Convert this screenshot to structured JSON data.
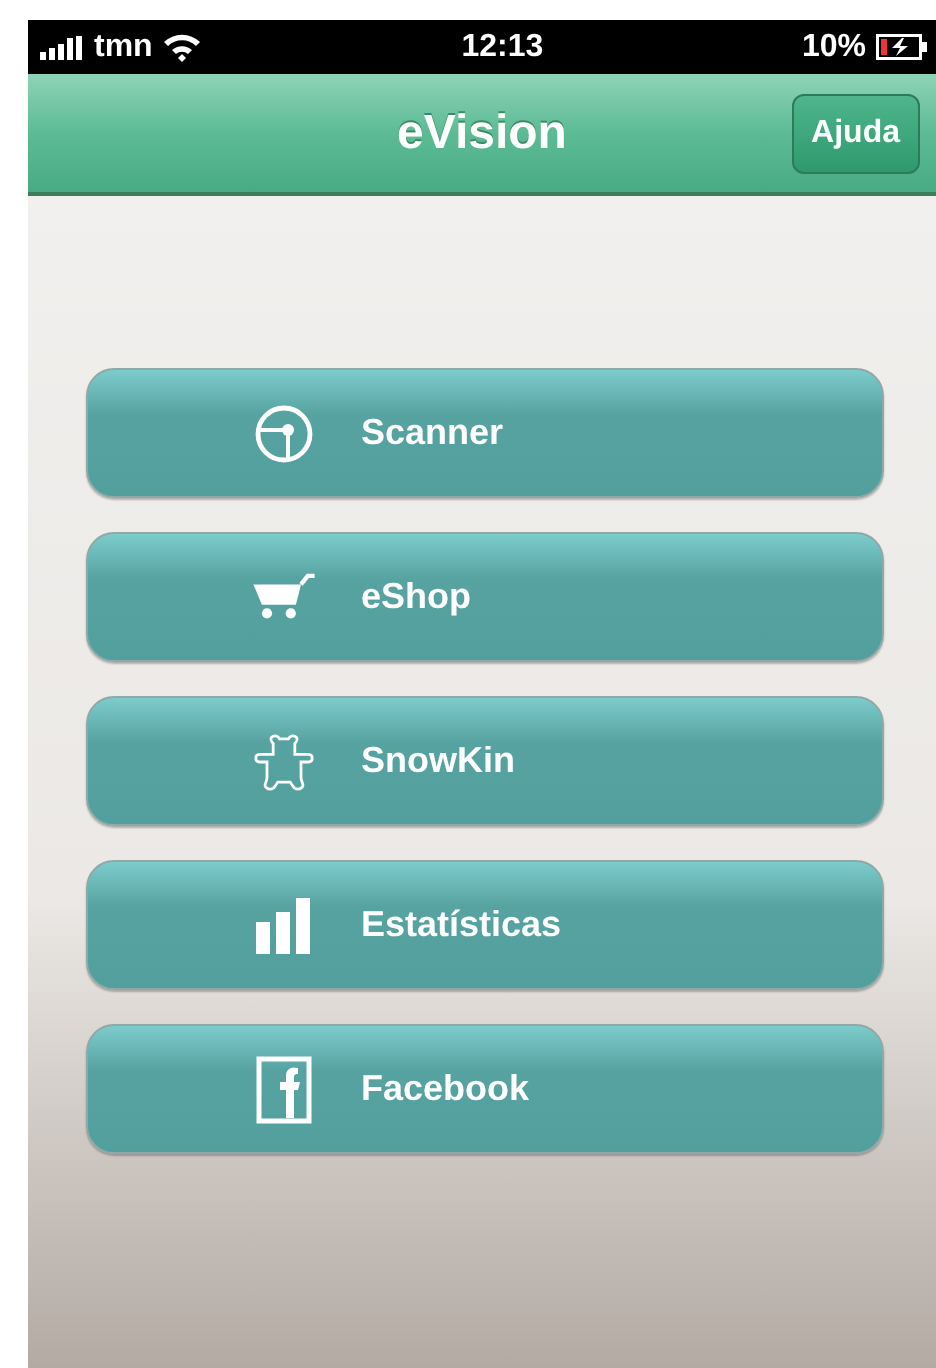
{
  "status_bar": {
    "carrier": "tmn",
    "time": "12:13",
    "battery": "10%"
  },
  "nav_bar": {
    "title": "eVision",
    "button": "Ajuda"
  },
  "menu": [
    {
      "label": "Scanner",
      "kind": "scanner"
    },
    {
      "label": "eShop",
      "kind": "cart"
    },
    {
      "label": "SnowKin",
      "kind": "bear"
    },
    {
      "label": "Estatísticas",
      "kind": "stats"
    },
    {
      "label": "Facebook",
      "kind": "facebook"
    }
  ]
}
